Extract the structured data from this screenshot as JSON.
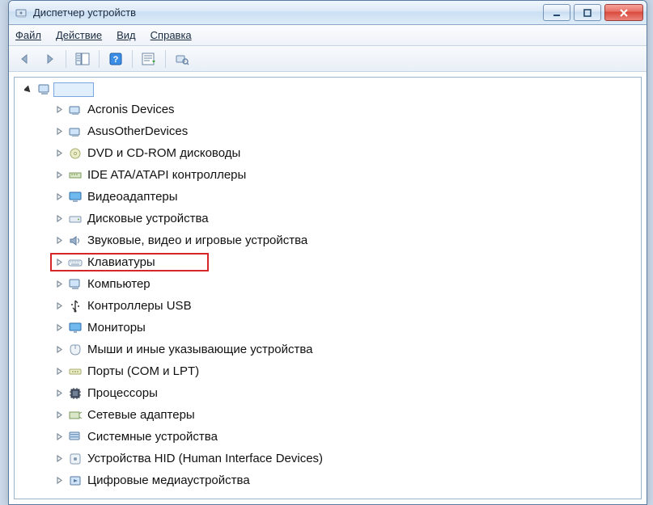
{
  "window": {
    "title": "Диспетчер устройств"
  },
  "menu": {
    "file": "Файл",
    "action": "Действие",
    "view": "Вид",
    "help": "Справка"
  },
  "tree": {
    "root": "",
    "items": [
      {
        "label": "Acronis Devices",
        "icon": "generic",
        "highlight": false
      },
      {
        "label": "AsusOtherDevices",
        "icon": "generic",
        "highlight": false
      },
      {
        "label": "DVD и CD-ROM дисководы",
        "icon": "disc",
        "highlight": false
      },
      {
        "label": "IDE ATA/ATAPI контроллеры",
        "icon": "ide",
        "highlight": false
      },
      {
        "label": "Видеоадаптеры",
        "icon": "display",
        "highlight": false
      },
      {
        "label": "Дисковые устройства",
        "icon": "drive",
        "highlight": false
      },
      {
        "label": "Звуковые, видео и игровые устройства",
        "icon": "audio",
        "highlight": false
      },
      {
        "label": "Клавиатуры",
        "icon": "keyboard",
        "highlight": true
      },
      {
        "label": "Компьютер",
        "icon": "computer",
        "highlight": false
      },
      {
        "label": "Контроллеры USB",
        "icon": "usb",
        "highlight": false
      },
      {
        "label": "Мониторы",
        "icon": "monitor",
        "highlight": false
      },
      {
        "label": "Мыши и иные указывающие устройства",
        "icon": "mouse",
        "highlight": false
      },
      {
        "label": "Порты (COM и LPT)",
        "icon": "port",
        "highlight": false
      },
      {
        "label": "Процессоры",
        "icon": "cpu",
        "highlight": false
      },
      {
        "label": "Сетевые адаптеры",
        "icon": "network",
        "highlight": false
      },
      {
        "label": "Системные устройства",
        "icon": "system",
        "highlight": false
      },
      {
        "label": "Устройства HID (Human Interface Devices)",
        "icon": "hid",
        "highlight": false
      },
      {
        "label": "Цифровые медиаустройства",
        "icon": "media",
        "highlight": false
      }
    ]
  }
}
